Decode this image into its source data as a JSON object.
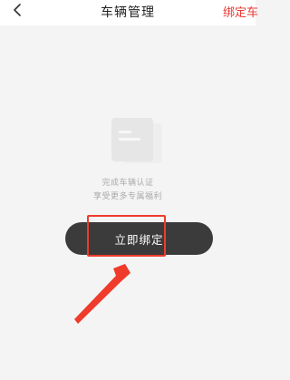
{
  "navbar": {
    "back_icon": "chevron-left-icon",
    "title": "车辆管理",
    "right_action": "绑定车"
  },
  "empty_state": {
    "icon": "document-icon",
    "line1": "完成车辆认证",
    "line2": "享受更多专属福利"
  },
  "primary_button": {
    "label": "立即绑定"
  },
  "annotation": {
    "color": "#ef3b2c"
  },
  "colors": {
    "background": "#f4f4f4",
    "button": "#3b3b3b",
    "accent_red": "#e53935"
  }
}
